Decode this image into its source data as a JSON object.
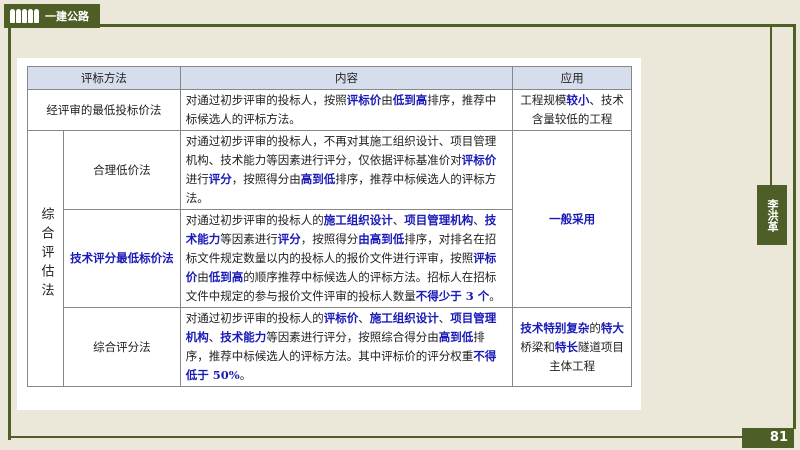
{
  "brand": {
    "title": "一建公路"
  },
  "side_tab": {
    "label": "李洪革"
  },
  "page_number": "81",
  "table": {
    "headers": [
      "评标方法",
      "内容",
      "应用"
    ],
    "group_label": "综合评估法",
    "rows": [
      {
        "method": "经评审的最低投标价法",
        "method_highlight": false,
        "content": [
          [
            "对通过初步评审的投标人，按照",
            0
          ],
          [
            "评标价",
            1
          ],
          [
            "由",
            0
          ],
          [
            "低到高",
            1
          ],
          [
            "排序，推荐中标候选人的评标方法。",
            0
          ]
        ],
        "application": [
          [
            "工程规模",
            0
          ],
          [
            "较小",
            1
          ],
          [
            "、技术含量较低的工程",
            0
          ]
        ]
      },
      {
        "method": "合理低价法",
        "method_highlight": false,
        "content": [
          [
            "对通过初步评审的投标人，不再对其施工组织设计、项目管理机构、技术能力等因素进行评分，仅依据评标基准价对",
            0
          ],
          [
            "评标价",
            1
          ],
          [
            "进行",
            0
          ],
          [
            "评分",
            1
          ],
          [
            "，按照得分由",
            0
          ],
          [
            "高到低",
            1
          ],
          [
            "排序，推荐中标候选人的评标方法。",
            0
          ]
        ],
        "application": [
          [
            "一般采用",
            1
          ]
        ]
      },
      {
        "method": "技术评分最低标价法",
        "method_highlight": true,
        "content": [
          [
            "对通过初步评审的投标人的",
            0
          ],
          [
            "施工组织设计",
            1
          ],
          [
            "、",
            0
          ],
          [
            "项目管理机构",
            1
          ],
          [
            "、",
            0
          ],
          [
            "技术能力",
            1
          ],
          [
            "等因素进行",
            0
          ],
          [
            "评分",
            1
          ],
          [
            "，按照得分",
            0
          ],
          [
            "由高到低",
            1
          ],
          [
            "排序，对排名在招标文件规定数量以内的投标人的报价文件进行评审，按照",
            0
          ],
          [
            "评标价",
            1
          ],
          [
            "由",
            0
          ],
          [
            "低到高",
            1
          ],
          [
            "的顺序推荐中标候选人的评标方法。招标人在招标文件中规定的参与报价文件评审的投标人数量",
            0
          ],
          [
            "不得少于 3 个",
            1
          ],
          [
            "。",
            0
          ]
        ]
      },
      {
        "method": "综合评分法",
        "method_highlight": false,
        "content": [
          [
            "对通过初步评审的投标人的",
            0
          ],
          [
            "评标价",
            1
          ],
          [
            "、",
            0
          ],
          [
            "施工组织设计",
            1
          ],
          [
            "、",
            0
          ],
          [
            "项目管理机构",
            1
          ],
          [
            "、",
            0
          ],
          [
            "技术能力",
            1
          ],
          [
            "等因素进行评分，按照综合得分由",
            0
          ],
          [
            "高到低",
            1
          ],
          [
            "排序，推荐中标候选人的评标方法。其中评标价的评分权重",
            0
          ],
          [
            "不得低于 50%",
            1
          ],
          [
            "。",
            0
          ]
        ],
        "application": [
          [
            "技术特别复杂",
            1
          ],
          [
            "的",
            0
          ],
          [
            "特大",
            1
          ],
          [
            "桥梁和",
            0
          ],
          [
            "特长",
            1
          ],
          [
            "隧道项目主体工程",
            0
          ]
        ]
      }
    ]
  }
}
